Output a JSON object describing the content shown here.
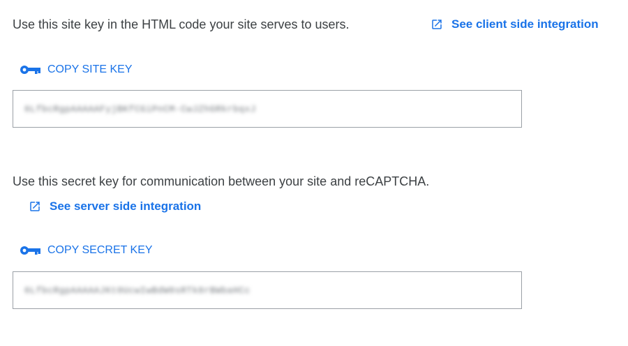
{
  "site_key_section": {
    "description": "Use this site key in the HTML code your site serves to users.",
    "integration_link": "See client side integration",
    "integration_link_icon": "open-in-new-icon",
    "copy_button_label": "COPY SITE KEY",
    "copy_button_icon": "key-icon",
    "key_value": "6LfbcRgpAAAAAFyjBKfCGiPnCM-CwJZhGRkrbqxJ"
  },
  "secret_key_section": {
    "description": "Use this secret key for communication between your site and reCAPTCHA.",
    "integration_link": "See server side integration",
    "integration_link_icon": "open-in-new-icon",
    "copy_button_label": "COPY SECRET KEY",
    "copy_button_icon": "key-icon",
    "key_value": "6LfbcRgpAAAAAJKt0UcwIwBdW0sRTk8rBWbaHCc"
  },
  "colors": {
    "accent": "#1a73e8",
    "text": "#3c4043",
    "border": "#9aa0a6"
  }
}
